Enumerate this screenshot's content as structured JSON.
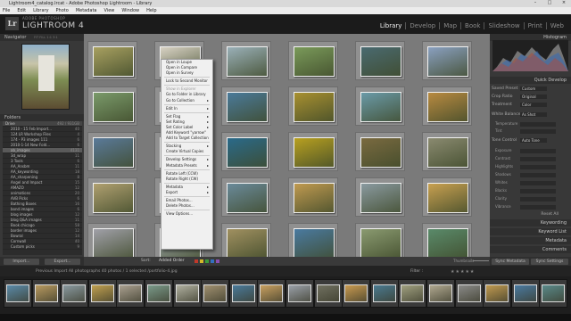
{
  "window": {
    "title": "Lightroom4_catalog.lrcat - Adobe Photoshop Lightroom - Library",
    "controls": [
      "–",
      "□",
      "×"
    ]
  },
  "menu": [
    "File",
    "Edit",
    "Library",
    "Photo",
    "Metadata",
    "View",
    "Window",
    "Help"
  ],
  "brand": {
    "logo": "Lr",
    "sub": "ADOBE PHOTOSHOP",
    "title": "LIGHTROOM 4"
  },
  "modules": [
    {
      "label": "Library",
      "active": true
    },
    {
      "label": "Develop"
    },
    {
      "label": "Map"
    },
    {
      "label": "Book"
    },
    {
      "label": "Slideshow"
    },
    {
      "label": "Print"
    },
    {
      "label": "Web"
    }
  ],
  "left_panel": {
    "navigator": {
      "label": "Navigator",
      "fit": "FIT FILL 1:1 3:1"
    },
    "folders": {
      "label": "Folders"
    },
    "volume": {
      "name": "Drive",
      "count": "492 / 931GB"
    },
    "rows": [
      {
        "label": "2010 - 15 Feb Import...",
        "count": "40"
      },
      {
        "label": "124 LR Workshop Files",
        "count": "4"
      },
      {
        "label": "174 - P3 images 111",
        "count": "6"
      },
      {
        "label": "2010-1-14 New Fold...",
        "count": "6"
      },
      {
        "label": "ab_images",
        "count": "4131"
      },
      {
        "label": "3d_wrap",
        "count": "11"
      },
      {
        "label": "3 Tools",
        "count": "6"
      },
      {
        "label": "AA_Ansbm",
        "count": "11"
      },
      {
        "label": "AA_keywording",
        "count": "18"
      },
      {
        "label": "AA_sharpening",
        "count": "8"
      },
      {
        "label": "Angel and Impact",
        "count": "15"
      },
      {
        "label": "AMAZO",
        "count": "12"
      },
      {
        "label": "animations",
        "count": "20"
      },
      {
        "label": "AVB Picks",
        "count": "6"
      },
      {
        "label": "Bathing Boxes",
        "count": "16"
      },
      {
        "label": "bond images",
        "count": "6"
      },
      {
        "label": "blog images",
        "count": "12"
      },
      {
        "label": "blog Q&A images",
        "count": "11"
      },
      {
        "label": "Book chicago",
        "count": "58"
      },
      {
        "label": "border images",
        "count": "12"
      },
      {
        "label": "Bowral",
        "count": "14"
      },
      {
        "label": "Cornwall",
        "count": "40"
      },
      {
        "label": "Custom picks",
        "count": "9"
      }
    ],
    "import_label": "Import...",
    "export_label": "Export..."
  },
  "grid": {
    "photos": [
      "#a8a060",
      "#d8d2c4",
      "#9ab0b8",
      "#7a9a5a",
      "#4a6a70",
      "#8aa0c0",
      "#7a9a6a",
      "#c8a070",
      "#4a7a9a",
      "#a89030",
      "#6a9aa8",
      "#b88a40",
      "#5a7a9a",
      "#c09a60",
      "#2a6a8a",
      "#b8a020",
      "#7a6a40",
      "#8a8a70",
      "#b0a070",
      "#c8c0b8",
      "#6a8a9a",
      "#c09a50",
      "#8a9aa0",
      "#c8a050",
      "#a0a0a8",
      "#b0b8c0",
      "#a09060",
      "#4a7aa0",
      "#8a9a70",
      "#5a8a6a"
    ]
  },
  "context_menu": {
    "items": [
      {
        "label": "Open in Loupe"
      },
      {
        "label": "Open in Compare"
      },
      {
        "label": "Open in Survey"
      },
      {
        "sep": true
      },
      {
        "label": "Lock to Second Monitor"
      },
      {
        "sep": true
      },
      {
        "label": "Show in Explorer",
        "disabled": true
      },
      {
        "label": "Go to Folder in Library"
      },
      {
        "label": "Go to Collection",
        "arrow": "▸"
      },
      {
        "sep": true
      },
      {
        "label": "Edit In",
        "arrow": "▸"
      },
      {
        "sep": true
      },
      {
        "label": "Set Flag",
        "arrow": "▸"
      },
      {
        "label": "Set Rating",
        "arrow": "▸"
      },
      {
        "label": "Set Color Label",
        "arrow": "▸"
      },
      {
        "label": "Add Keyword \"yarrow\""
      },
      {
        "label": "Add to Target Collection"
      },
      {
        "sep": true
      },
      {
        "label": "Stacking",
        "arrow": "▸"
      },
      {
        "label": "Create Virtual Copies"
      },
      {
        "sep": true
      },
      {
        "label": "Develop Settings",
        "arrow": "▸"
      },
      {
        "label": "Metadata Presets",
        "arrow": "▸"
      },
      {
        "sep": true
      },
      {
        "label": "Rotate Left (CCW)"
      },
      {
        "label": "Rotate Right (CW)"
      },
      {
        "sep": true
      },
      {
        "label": "Metadata",
        "arrow": "▸"
      },
      {
        "label": "Export",
        "arrow": "▸"
      },
      {
        "sep": true
      },
      {
        "label": "Email Photos..."
      },
      {
        "label": "Delete Photos..."
      },
      {
        "sep": true
      },
      {
        "label": "View Options..."
      }
    ]
  },
  "toolbar": {
    "sort_label": "Sort:",
    "sort_value": "Added Order",
    "thumbnails_label": "Thumbnails"
  },
  "color_labels": [
    "#c0392b",
    "#d4b82a",
    "#3b9b3b",
    "#3370c0",
    "#8a4fb0"
  ],
  "right_panel": {
    "histogram": {
      "label": "Histogram"
    },
    "quick_develop": {
      "label": "Quick Develop"
    },
    "rows": [
      {
        "label": "Saved Preset",
        "value": "Custom"
      },
      {
        "label": "Crop Ratio",
        "value": "Original"
      },
      {
        "label": "Treatment",
        "value": "Color"
      }
    ],
    "white_balance": {
      "label": "White Balance",
      "value": "As Shot"
    },
    "wb_rows": [
      "Temperature",
      "Tint"
    ],
    "tone_label": "Tone Control",
    "tone_value": "Auto Tone",
    "tone_rows": [
      "Exposure",
      "Contrast",
      "Highlights",
      "Shadows",
      "Whites",
      "Blacks",
      "Clarity",
      "Vibrance"
    ],
    "reset_label": "Reset All",
    "sections": [
      "Keywording",
      "Keyword List",
      "Metadata",
      "Comments"
    ],
    "sync_metadata": "Sync Metadata",
    "sync_settings": "Sync Settings"
  },
  "filmstrip": {
    "info": "Previous Import   All photographs   40 photos / 1 selected /portfolio-4.jpg",
    "filter_label": "Filter :",
    "stars": "★★★★★",
    "photos": [
      "#5a8aa8",
      "#b89a60",
      "#8a9aa0",
      "#c0a050",
      "#aaa090",
      "#7a9a8a",
      "#b0b0a0",
      "#a09070",
      "#4a7a9a",
      "#c8a060",
      "#9aa0a8",
      "#707060",
      "#c89a50",
      "#4a7a90",
      "#a0a080",
      "#b0a890",
      "#8a8a88",
      "#c09a50",
      "#4a7aa0",
      "#5a8a8a"
    ]
  }
}
